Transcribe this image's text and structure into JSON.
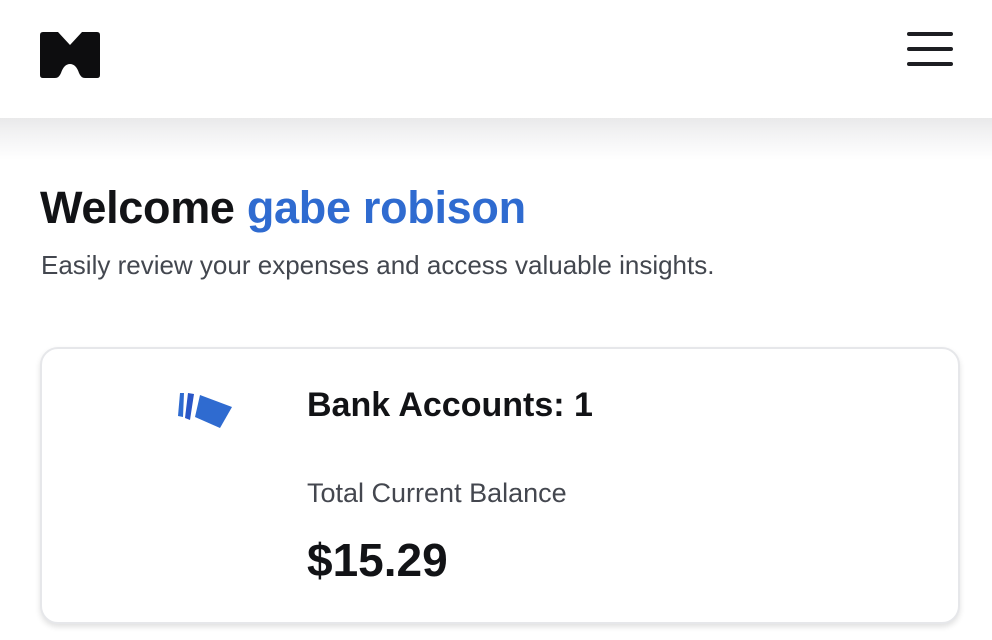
{
  "header": {
    "logo_icon": "brand-m-logo",
    "menu_icon": "hamburger-menu-icon"
  },
  "welcome": {
    "greeting": "Welcome",
    "user_name": "gabe robison",
    "subtitle": "Easily review your expenses and access valuable insights."
  },
  "summary_card": {
    "icon": "bank-cards-icon",
    "bank_accounts_label": "Bank Accounts: 1",
    "balance_label": "Total Current Balance",
    "balance_value": "$15.29"
  },
  "colors": {
    "accent": "#2f6bd0",
    "text_primary": "#121316",
    "text_secondary": "#43474f"
  }
}
